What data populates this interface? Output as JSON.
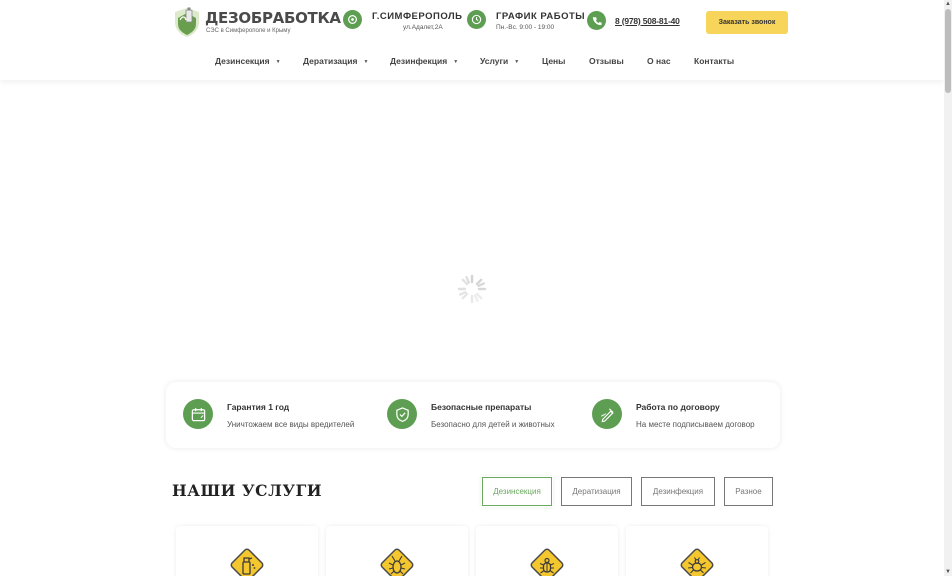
{
  "header": {
    "logo": {
      "name": "ДЕЗОБРАБОТКА",
      "tagline": "СЭС в Симферополе и Крыму"
    },
    "location": {
      "title": "Г.СИМФЕРОПОЛЬ",
      "address": "ул.Адалет,2А",
      "icon": "location-pin-icon"
    },
    "schedule": {
      "title": "ГРАФИК РАБОТЫ",
      "hours": "Пн.-Вс. 9:00 - 19:00",
      "icon": "clock-icon"
    },
    "phone": {
      "number": "8 (978) 508-81-40",
      "icon": "phone-icon"
    },
    "callback_label": "Заказать звонок",
    "accent_green": "#5e9e53",
    "accent_yellow": "#f7d45a"
  },
  "nav": {
    "items": [
      {
        "label": "Дезинсекция",
        "dropdown": "▼"
      },
      {
        "label": "Дератизация",
        "dropdown": "▼"
      },
      {
        "label": "Дезинфекция",
        "dropdown": "▼"
      },
      {
        "label": "Услуги",
        "dropdown": "▼"
      },
      {
        "label": "Цены"
      },
      {
        "label": "Отзывы"
      },
      {
        "label": "О нас"
      },
      {
        "label": "Контакты"
      }
    ]
  },
  "features": [
    {
      "title": "Гарантия 1 год",
      "desc": "Уничтожаем все виды вредителей",
      "icon": "calendar-icon"
    },
    {
      "title": "Безопасные препараты",
      "desc": "Безопасно для детей и животных",
      "icon": "shield-check-icon"
    },
    {
      "title": "Работа по договору",
      "desc": "На месте подписываем договор",
      "icon": "contract-pen-icon"
    }
  ],
  "services": {
    "title": "НАШИ УСЛУГИ",
    "tabs": [
      "Дезинсекция",
      "Дератизация",
      "Дезинфекция",
      "Разное"
    ],
    "active_tab": "Дезинсекция",
    "cards": [
      {
        "icon": "spray-bottle-icon"
      },
      {
        "icon": "cockroach-icon"
      },
      {
        "icon": "beetle-icon"
      },
      {
        "icon": "bug-icon"
      }
    ]
  },
  "scrollbar": {
    "up": "▲",
    "down": "▼"
  }
}
